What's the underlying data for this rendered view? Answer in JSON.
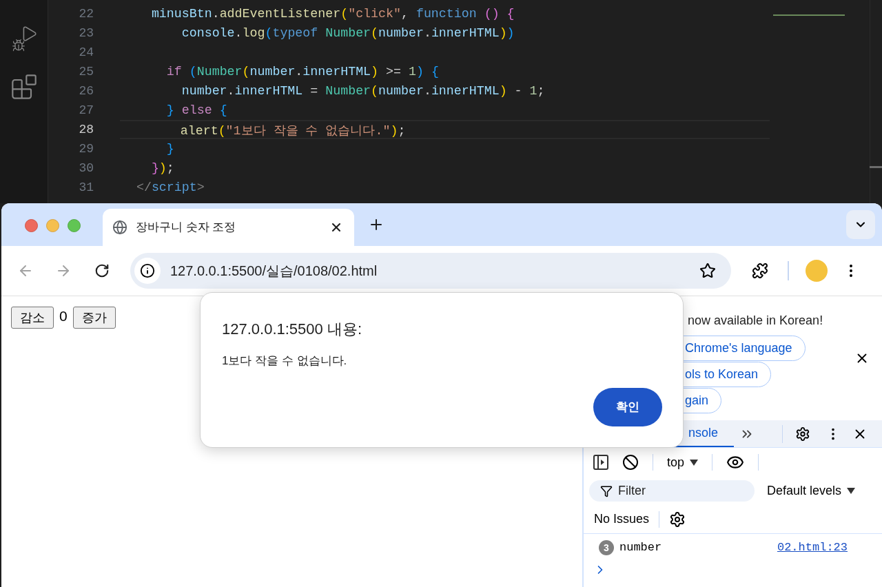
{
  "editor": {
    "lines": [
      {
        "number": "22",
        "current": false,
        "tokens": [
          {
            "text": "    minusBtn",
            "kind": "var"
          },
          {
            "text": ".",
            "kind": "op"
          },
          {
            "text": "addEventListener",
            "kind": "fn"
          },
          {
            "text": "(",
            "kind": "b1"
          },
          {
            "text": "\"click\"",
            "kind": "str"
          },
          {
            "text": ",",
            "kind": "op"
          },
          {
            "text": " function",
            "kind": "kw"
          },
          {
            "text": " ()",
            "kind": "b2"
          },
          {
            "text": " {",
            "kind": "b2"
          }
        ]
      },
      {
        "number": "23",
        "current": false,
        "tokens": [
          {
            "text": "        console",
            "kind": "var"
          },
          {
            "text": ".",
            "kind": "op"
          },
          {
            "text": "log",
            "kind": "fn"
          },
          {
            "text": "(",
            "kind": "b3"
          },
          {
            "text": "typeof",
            "kind": "kw"
          },
          {
            "text": " Number",
            "kind": "type"
          },
          {
            "text": "(",
            "kind": "b1"
          },
          {
            "text": "number",
            "kind": "var"
          },
          {
            "text": ".",
            "kind": "op"
          },
          {
            "text": "innerHTML",
            "kind": "var"
          },
          {
            "text": ")",
            "kind": "b1"
          },
          {
            "text": ")",
            "kind": "b3"
          }
        ]
      },
      {
        "number": "24",
        "current": false
      },
      {
        "number": "25",
        "current": false,
        "tokens": [
          {
            "text": "      if",
            "kind": "ctl"
          },
          {
            "text": " (",
            "kind": "b3"
          },
          {
            "text": "Number",
            "kind": "type"
          },
          {
            "text": "(",
            "kind": "b1"
          },
          {
            "text": "number",
            "kind": "var"
          },
          {
            "text": ".",
            "kind": "op"
          },
          {
            "text": "innerHTML",
            "kind": "var"
          },
          {
            "text": ")",
            "kind": "b1"
          },
          {
            "text": " >=",
            "kind": "op"
          },
          {
            "text": " 1",
            "kind": "num"
          },
          {
            "text": ")",
            "kind": "b3"
          },
          {
            "text": " {",
            "kind": "b3"
          }
        ]
      },
      {
        "number": "26",
        "current": false,
        "tokens": [
          {
            "text": "        number",
            "kind": "var"
          },
          {
            "text": ".",
            "kind": "op"
          },
          {
            "text": "innerHTML",
            "kind": "var"
          },
          {
            "text": " =",
            "kind": "op"
          },
          {
            "text": " Number",
            "kind": "type"
          },
          {
            "text": "(",
            "kind": "b1"
          },
          {
            "text": "number",
            "kind": "var"
          },
          {
            "text": ".",
            "kind": "op"
          },
          {
            "text": "innerHTML",
            "kind": "var"
          },
          {
            "text": ")",
            "kind": "b1"
          },
          {
            "text": " -",
            "kind": "op"
          },
          {
            "text": " 1",
            "kind": "num"
          },
          {
            "text": ";",
            "kind": "op"
          }
        ]
      },
      {
        "number": "27",
        "current": false,
        "tokens": [
          {
            "text": "      }",
            "kind": "b3"
          },
          {
            "text": " else",
            "kind": "ctl"
          },
          {
            "text": " {",
            "kind": "b3"
          }
        ]
      },
      {
        "number": "28",
        "current": true,
        "tokens": [
          {
            "text": "        alert",
            "kind": "fn"
          },
          {
            "text": "(",
            "kind": "b1"
          },
          {
            "text": "\"1보다 작을 수 없습니다.\"",
            "kind": "str"
          },
          {
            "text": ")",
            "kind": "b1"
          },
          {
            "text": ";",
            "kind": "op"
          }
        ]
      },
      {
        "number": "29",
        "current": false,
        "tokens": [
          {
            "text": "      }",
            "kind": "b3"
          }
        ]
      },
      {
        "number": "30",
        "current": false,
        "tokens": [
          {
            "text": "    }",
            "kind": "b2"
          },
          {
            "text": ")",
            "kind": "b1"
          },
          {
            "text": ";",
            "kind": "op"
          }
        ]
      },
      {
        "number": "31",
        "current": false,
        "tokens": [
          {
            "text": "  </",
            "kind": "tag"
          },
          {
            "text": "script",
            "kind": "kw"
          },
          {
            "text": ">",
            "kind": "tag"
          }
        ]
      }
    ]
  },
  "browser": {
    "tab": {
      "title": "장바구니 숫자 조정",
      "selected": true
    },
    "url": "127.0.0.1:5500/실습/0108/02.html"
  },
  "page": {
    "buttons": [
      "감소",
      "증가"
    ],
    "count": "0"
  },
  "dialog": {
    "title": "127.0.0.1:5500 내용:",
    "message": "1보다 작을 수 없습니다.",
    "ok_button": "확인"
  },
  "devtools": {
    "banner_text": "now available in Korean!",
    "banner_buttons": [
      "Chrome's language",
      "ols to Korean",
      "gain"
    ],
    "tabs": [
      {
        "label": "nsole",
        "selected": true
      }
    ],
    "context": "top",
    "filter_placeholder": "Filter",
    "levels": "Default levels",
    "issues": "No Issues",
    "messages": [
      {
        "count": "3",
        "text": "number",
        "source": "02.html:23"
      }
    ]
  }
}
